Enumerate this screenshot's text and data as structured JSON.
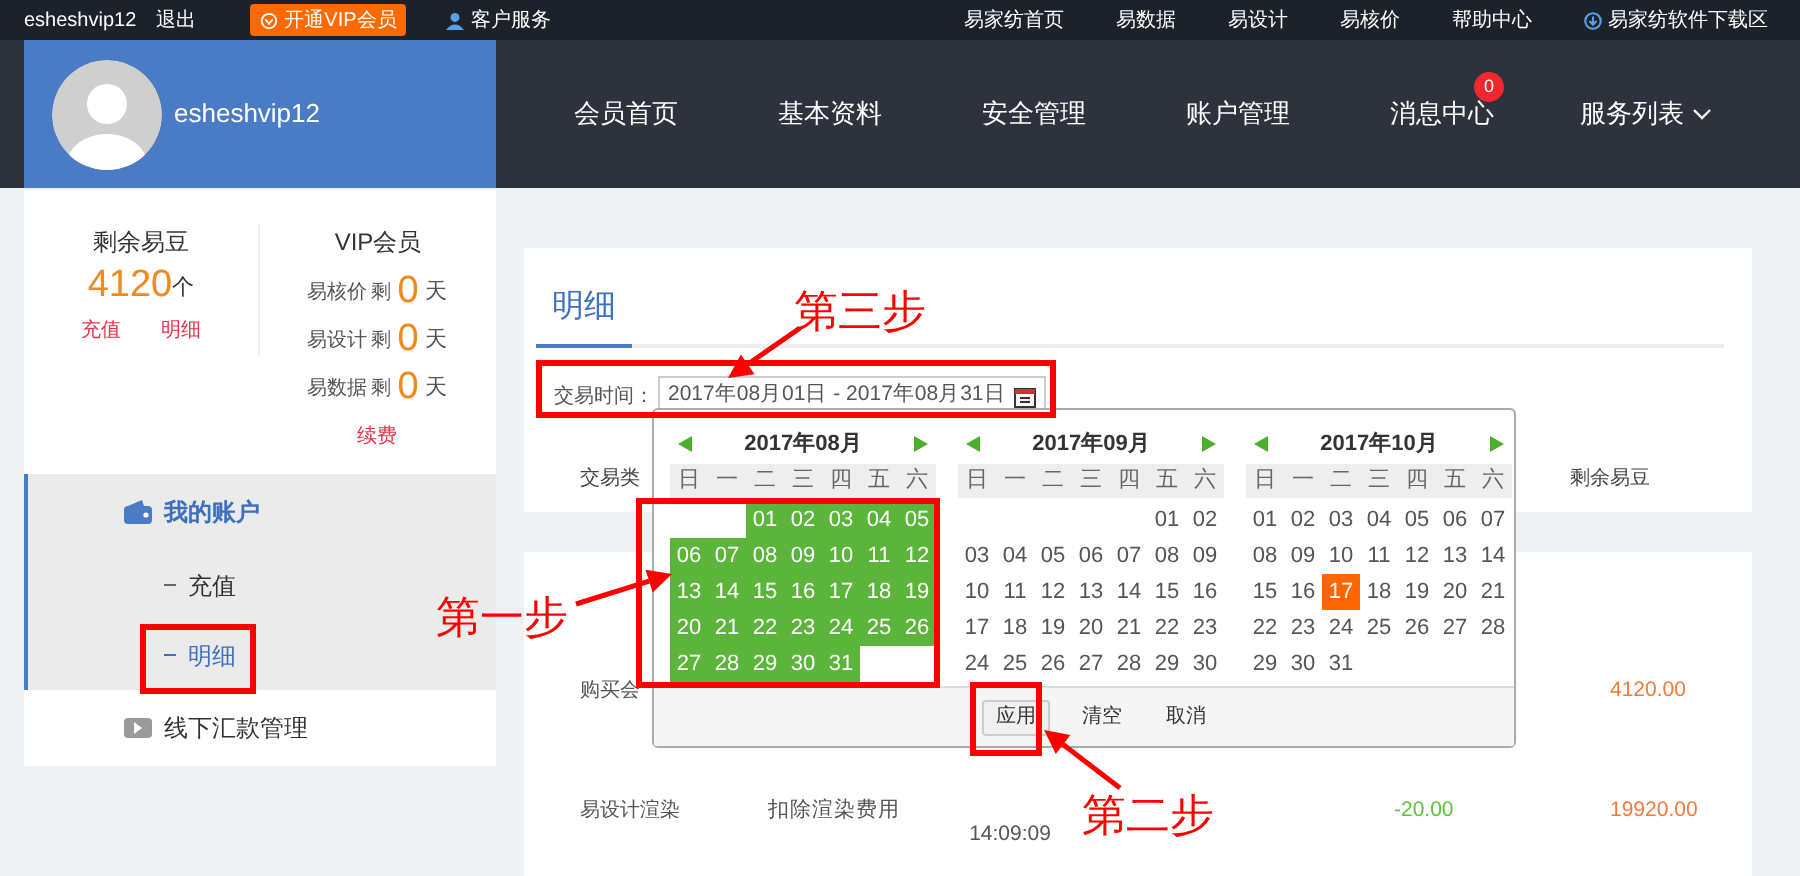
{
  "top_bar": {
    "username": "esheshvip12",
    "logout": "退出",
    "vip_button": "开通VIP会员",
    "service": "客户服务",
    "links": [
      "易家纺首页",
      "易数据",
      "易设计",
      "易核价",
      "帮助中心"
    ],
    "download": "易家纺软件下载区"
  },
  "profile": {
    "username": "esheshvip12"
  },
  "nav": [
    {
      "label": "会员首页",
      "dropdown": false
    },
    {
      "label": "基本资料",
      "dropdown": false
    },
    {
      "label": "安全管理",
      "dropdown": false
    },
    {
      "label": "账户管理",
      "dropdown": false
    },
    {
      "label": "消息中心",
      "badge": "0",
      "dropdown": false
    },
    {
      "label": "服务列表",
      "dropdown": true
    }
  ],
  "balance": {
    "title": "剩余易豆",
    "amount": "4120",
    "unit": "个",
    "links": [
      "充值",
      "明细"
    ]
  },
  "vip": {
    "title": "VIP会员",
    "rows": [
      {
        "service": "易核价",
        "left": "剩",
        "days": "0",
        "unit": "天"
      },
      {
        "service": "易设计",
        "left": "剩",
        "days": "0",
        "unit": "天"
      },
      {
        "service": "易数据",
        "left": "剩",
        "days": "0",
        "unit": "天"
      }
    ],
    "renew": "续费"
  },
  "menu": [
    {
      "label": "我的账户",
      "kind": "wallet",
      "expanded": true,
      "children": [
        {
          "label": "充值",
          "selected": false
        },
        {
          "label": "明细",
          "selected": true
        }
      ]
    },
    {
      "label": "线下汇款管理",
      "kind": "transfer",
      "expanded": false
    }
  ],
  "tab": {
    "label": "明细",
    "selected": true
  },
  "filter": {
    "label": "交易时间：",
    "value": "2017年08月01日 - 2017年08月31日"
  },
  "table": {
    "columns": [
      "交易类",
      "剩余易豆"
    ],
    "rows": [
      {
        "type": "购买会",
        "balance": "4120.00"
      },
      {
        "type": "易设计渲染",
        "description": "扣除渲染费用",
        "time": "14:09:09",
        "amount": "-20.00",
        "balance": "19920.00"
      }
    ]
  },
  "date_picker": {
    "months": [
      {
        "title": "2017年08月",
        "weekdays": [
          "日",
          "一",
          "二",
          "三",
          "四",
          "五",
          "六"
        ],
        "weeks": [
          [
            {
              "kind": "blank"
            },
            {
              "kind": "blank"
            },
            {
              "kind": "day",
              "label": "01",
              "selected": true,
              "today": false
            },
            {
              "kind": "day",
              "label": "02",
              "selected": true,
              "today": false
            },
            {
              "kind": "day",
              "label": "03",
              "selected": true,
              "today": false
            },
            {
              "kind": "day",
              "label": "04",
              "selected": true,
              "today": false
            },
            {
              "kind": "day",
              "label": "05",
              "selected": true,
              "today": false
            }
          ],
          [
            {
              "kind": "day",
              "label": "06",
              "selected": true,
              "today": false
            },
            {
              "kind": "day",
              "label": "07",
              "selected": true,
              "today": false
            },
            {
              "kind": "day",
              "label": "08",
              "selected": true,
              "today": false
            },
            {
              "kind": "day",
              "label": "09",
              "selected": true,
              "today": false
            },
            {
              "kind": "day",
              "label": "10",
              "selected": true,
              "today": false
            },
            {
              "kind": "day",
              "label": "11",
              "selected": true,
              "today": false
            },
            {
              "kind": "day",
              "label": "12",
              "selected": true,
              "today": false
            }
          ],
          [
            {
              "kind": "day",
              "label": "13",
              "selected": true,
              "today": false
            },
            {
              "kind": "day",
              "label": "14",
              "selected": true,
              "today": false
            },
            {
              "kind": "day",
              "label": "15",
              "selected": true,
              "today": false
            },
            {
              "kind": "day",
              "label": "16",
              "selected": true,
              "today": false
            },
            {
              "kind": "day",
              "label": "17",
              "selected": true,
              "today": false
            },
            {
              "kind": "day",
              "label": "18",
              "selected": true,
              "today": false
            },
            {
              "kind": "day",
              "label": "19",
              "selected": true,
              "today": false
            }
          ],
          [
            {
              "kind": "day",
              "label": "20",
              "selected": true,
              "today": false
            },
            {
              "kind": "day",
              "label": "21",
              "selected": true,
              "today": false
            },
            {
              "kind": "day",
              "label": "22",
              "selected": true,
              "today": false
            },
            {
              "kind": "day",
              "label": "23",
              "selected": true,
              "today": false
            },
            {
              "kind": "day",
              "label": "24",
              "selected": true,
              "today": false
            },
            {
              "kind": "day",
              "label": "25",
              "selected": true,
              "today": false
            },
            {
              "kind": "day",
              "label": "26",
              "selected": true,
              "today": false
            }
          ],
          [
            {
              "kind": "day",
              "label": "27",
              "selected": true,
              "today": false
            },
            {
              "kind": "day",
              "label": "28",
              "selected": true,
              "today": false
            },
            {
              "kind": "day",
              "label": "29",
              "selected": true,
              "today": false
            },
            {
              "kind": "day",
              "label": "30",
              "selected": true,
              "today": false
            },
            {
              "kind": "day",
              "label": "31",
              "selected": true,
              "today": false
            }
          ]
        ]
      },
      {
        "title": "2017年09月",
        "weekdays": [
          "日",
          "一",
          "二",
          "三",
          "四",
          "五",
          "六"
        ],
        "weeks": [
          [
            {
              "kind": "blank"
            },
            {
              "kind": "blank"
            },
            {
              "kind": "blank"
            },
            {
              "kind": "blank"
            },
            {
              "kind": "blank"
            },
            {
              "kind": "day",
              "label": "01",
              "selected": false,
              "today": false
            },
            {
              "kind": "day",
              "label": "02",
              "selected": false,
              "today": false
            }
          ],
          [
            {
              "kind": "day",
              "label": "03",
              "selected": false,
              "today": false
            },
            {
              "kind": "day",
              "label": "04",
              "selected": false,
              "today": false
            },
            {
              "kind": "day",
              "label": "05",
              "selected": false,
              "today": false
            },
            {
              "kind": "day",
              "label": "06",
              "selected": false,
              "today": false
            },
            {
              "kind": "day",
              "label": "07",
              "selected": false,
              "today": false
            },
            {
              "kind": "day",
              "label": "08",
              "selected": false,
              "today": false
            },
            {
              "kind": "day",
              "label": "09",
              "selected": false,
              "today": false
            }
          ],
          [
            {
              "kind": "day",
              "label": "10",
              "selected": false,
              "today": false
            },
            {
              "kind": "day",
              "label": "11",
              "selected": false,
              "today": false
            },
            {
              "kind": "day",
              "label": "12",
              "selected": false,
              "today": false
            },
            {
              "kind": "day",
              "label": "13",
              "selected": false,
              "today": false
            },
            {
              "kind": "day",
              "label": "14",
              "selected": false,
              "today": false
            },
            {
              "kind": "day",
              "label": "15",
              "selected": false,
              "today": false
            },
            {
              "kind": "day",
              "label": "16",
              "selected": false,
              "today": false
            }
          ],
          [
            {
              "kind": "day",
              "label": "17",
              "selected": false,
              "today": false
            },
            {
              "kind": "day",
              "label": "18",
              "selected": false,
              "today": false
            },
            {
              "kind": "day",
              "label": "19",
              "selected": false,
              "today": false
            },
            {
              "kind": "day",
              "label": "20",
              "selected": false,
              "today": false
            },
            {
              "kind": "day",
              "label": "21",
              "selected": false,
              "today": false
            },
            {
              "kind": "day",
              "label": "22",
              "selected": false,
              "today": false
            },
            {
              "kind": "day",
              "label": "23",
              "selected": false,
              "today": false
            }
          ],
          [
            {
              "kind": "day",
              "label": "24",
              "selected": false,
              "today": false
            },
            {
              "kind": "day",
              "label": "25",
              "selected": false,
              "today": false
            },
            {
              "kind": "day",
              "label": "26",
              "selected": false,
              "today": false
            },
            {
              "kind": "day",
              "label": "27",
              "selected": false,
              "today": false
            },
            {
              "kind": "day",
              "label": "28",
              "selected": false,
              "today": false
            },
            {
              "kind": "day",
              "label": "29",
              "selected": false,
              "today": false
            },
            {
              "kind": "day",
              "label": "30",
              "selected": false,
              "today": false
            }
          ]
        ]
      },
      {
        "title": "2017年10月",
        "weekdays": [
          "日",
          "一",
          "二",
          "三",
          "四",
          "五",
          "六"
        ],
        "weeks": [
          [
            {
              "kind": "day",
              "label": "01",
              "selected": false,
              "today": false
            },
            {
              "kind": "day",
              "label": "02",
              "selected": false,
              "today": false
            },
            {
              "kind": "day",
              "label": "03",
              "selected": false,
              "today": false
            },
            {
              "kind": "day",
              "label": "04",
              "selected": false,
              "today": false
            },
            {
              "kind": "day",
              "label": "05",
              "selected": false,
              "today": false
            },
            {
              "kind": "day",
              "label": "06",
              "selected": false,
              "today": false
            },
            {
              "kind": "day",
              "label": "07",
              "selected": false,
              "today": false
            }
          ],
          [
            {
              "kind": "day",
              "label": "08",
              "selected": false,
              "today": false
            },
            {
              "kind": "day",
              "label": "09",
              "selected": false,
              "today": false
            },
            {
              "kind": "day",
              "label": "10",
              "selected": false,
              "today": false
            },
            {
              "kind": "day",
              "label": "11",
              "selected": false,
              "today": false
            },
            {
              "kind": "day",
              "label": "12",
              "selected": false,
              "today": false
            },
            {
              "kind": "day",
              "label": "13",
              "selected": false,
              "today": false
            },
            {
              "kind": "day",
              "label": "14",
              "selected": false,
              "today": false
            }
          ],
          [
            {
              "kind": "day",
              "label": "15",
              "selected": false,
              "today": false
            },
            {
              "kind": "day",
              "label": "16",
              "selected": false,
              "today": false
            },
            {
              "kind": "day",
              "label": "17",
              "selected": false,
              "today": true
            },
            {
              "kind": "day",
              "label": "18",
              "selected": false,
              "today": false
            },
            {
              "kind": "day",
              "label": "19",
              "selected": false,
              "today": false
            },
            {
              "kind": "day",
              "label": "20",
              "selected": false,
              "today": false
            },
            {
              "kind": "day",
              "label": "21",
              "selected": false,
              "today": false
            }
          ],
          [
            {
              "kind": "day",
              "label": "22",
              "selected": false,
              "today": false
            },
            {
              "kind": "day",
              "label": "23",
              "selected": false,
              "today": false
            },
            {
              "kind": "day",
              "label": "24",
              "selected": false,
              "today": false
            },
            {
              "kind": "day",
              "label": "25",
              "selected": false,
              "today": false
            },
            {
              "kind": "day",
              "label": "26",
              "selected": false,
              "today": false
            },
            {
              "kind": "day",
              "label": "27",
              "selected": false,
              "today": false
            },
            {
              "kind": "day",
              "label": "28",
              "selected": false,
              "today": false
            }
          ],
          [
            {
              "kind": "day",
              "label": "29",
              "selected": false,
              "today": false
            },
            {
              "kind": "day",
              "label": "30",
              "selected": false,
              "today": false
            },
            {
              "kind": "day",
              "label": "31",
              "selected": false,
              "today": false
            }
          ]
        ]
      }
    ],
    "buttons": [
      "应用",
      "清空",
      "取消"
    ]
  },
  "annotations": [
    {
      "text": "第三步"
    },
    {
      "text": "第一步"
    },
    {
      "text": "第二步"
    }
  ]
}
